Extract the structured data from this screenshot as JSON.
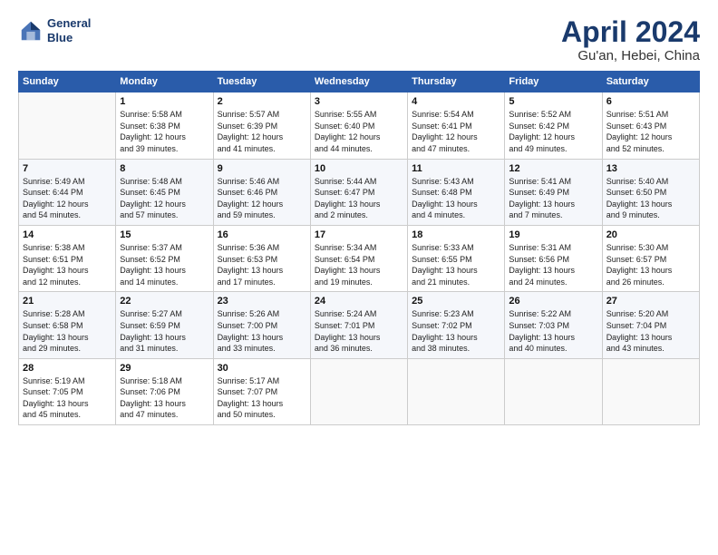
{
  "logo": {
    "line1": "General",
    "line2": "Blue"
  },
  "title": {
    "month_year": "April 2024",
    "location": "Gu'an, Hebei, China"
  },
  "weekdays": [
    "Sunday",
    "Monday",
    "Tuesday",
    "Wednesday",
    "Thursday",
    "Friday",
    "Saturday"
  ],
  "weeks": [
    [
      {
        "day": "",
        "detail": ""
      },
      {
        "day": "1",
        "detail": "Sunrise: 5:58 AM\nSunset: 6:38 PM\nDaylight: 12 hours\nand 39 minutes."
      },
      {
        "day": "2",
        "detail": "Sunrise: 5:57 AM\nSunset: 6:39 PM\nDaylight: 12 hours\nand 41 minutes."
      },
      {
        "day": "3",
        "detail": "Sunrise: 5:55 AM\nSunset: 6:40 PM\nDaylight: 12 hours\nand 44 minutes."
      },
      {
        "day": "4",
        "detail": "Sunrise: 5:54 AM\nSunset: 6:41 PM\nDaylight: 12 hours\nand 47 minutes."
      },
      {
        "day": "5",
        "detail": "Sunrise: 5:52 AM\nSunset: 6:42 PM\nDaylight: 12 hours\nand 49 minutes."
      },
      {
        "day": "6",
        "detail": "Sunrise: 5:51 AM\nSunset: 6:43 PM\nDaylight: 12 hours\nand 52 minutes."
      }
    ],
    [
      {
        "day": "7",
        "detail": "Sunrise: 5:49 AM\nSunset: 6:44 PM\nDaylight: 12 hours\nand 54 minutes."
      },
      {
        "day": "8",
        "detail": "Sunrise: 5:48 AM\nSunset: 6:45 PM\nDaylight: 12 hours\nand 57 minutes."
      },
      {
        "day": "9",
        "detail": "Sunrise: 5:46 AM\nSunset: 6:46 PM\nDaylight: 12 hours\nand 59 minutes."
      },
      {
        "day": "10",
        "detail": "Sunrise: 5:44 AM\nSunset: 6:47 PM\nDaylight: 13 hours\nand 2 minutes."
      },
      {
        "day": "11",
        "detail": "Sunrise: 5:43 AM\nSunset: 6:48 PM\nDaylight: 13 hours\nand 4 minutes."
      },
      {
        "day": "12",
        "detail": "Sunrise: 5:41 AM\nSunset: 6:49 PM\nDaylight: 13 hours\nand 7 minutes."
      },
      {
        "day": "13",
        "detail": "Sunrise: 5:40 AM\nSunset: 6:50 PM\nDaylight: 13 hours\nand 9 minutes."
      }
    ],
    [
      {
        "day": "14",
        "detail": "Sunrise: 5:38 AM\nSunset: 6:51 PM\nDaylight: 13 hours\nand 12 minutes."
      },
      {
        "day": "15",
        "detail": "Sunrise: 5:37 AM\nSunset: 6:52 PM\nDaylight: 13 hours\nand 14 minutes."
      },
      {
        "day": "16",
        "detail": "Sunrise: 5:36 AM\nSunset: 6:53 PM\nDaylight: 13 hours\nand 17 minutes."
      },
      {
        "day": "17",
        "detail": "Sunrise: 5:34 AM\nSunset: 6:54 PM\nDaylight: 13 hours\nand 19 minutes."
      },
      {
        "day": "18",
        "detail": "Sunrise: 5:33 AM\nSunset: 6:55 PM\nDaylight: 13 hours\nand 21 minutes."
      },
      {
        "day": "19",
        "detail": "Sunrise: 5:31 AM\nSunset: 6:56 PM\nDaylight: 13 hours\nand 24 minutes."
      },
      {
        "day": "20",
        "detail": "Sunrise: 5:30 AM\nSunset: 6:57 PM\nDaylight: 13 hours\nand 26 minutes."
      }
    ],
    [
      {
        "day": "21",
        "detail": "Sunrise: 5:28 AM\nSunset: 6:58 PM\nDaylight: 13 hours\nand 29 minutes."
      },
      {
        "day": "22",
        "detail": "Sunrise: 5:27 AM\nSunset: 6:59 PM\nDaylight: 13 hours\nand 31 minutes."
      },
      {
        "day": "23",
        "detail": "Sunrise: 5:26 AM\nSunset: 7:00 PM\nDaylight: 13 hours\nand 33 minutes."
      },
      {
        "day": "24",
        "detail": "Sunrise: 5:24 AM\nSunset: 7:01 PM\nDaylight: 13 hours\nand 36 minutes."
      },
      {
        "day": "25",
        "detail": "Sunrise: 5:23 AM\nSunset: 7:02 PM\nDaylight: 13 hours\nand 38 minutes."
      },
      {
        "day": "26",
        "detail": "Sunrise: 5:22 AM\nSunset: 7:03 PM\nDaylight: 13 hours\nand 40 minutes."
      },
      {
        "day": "27",
        "detail": "Sunrise: 5:20 AM\nSunset: 7:04 PM\nDaylight: 13 hours\nand 43 minutes."
      }
    ],
    [
      {
        "day": "28",
        "detail": "Sunrise: 5:19 AM\nSunset: 7:05 PM\nDaylight: 13 hours\nand 45 minutes."
      },
      {
        "day": "29",
        "detail": "Sunrise: 5:18 AM\nSunset: 7:06 PM\nDaylight: 13 hours\nand 47 minutes."
      },
      {
        "day": "30",
        "detail": "Sunrise: 5:17 AM\nSunset: 7:07 PM\nDaylight: 13 hours\nand 50 minutes."
      },
      {
        "day": "",
        "detail": ""
      },
      {
        "day": "",
        "detail": ""
      },
      {
        "day": "",
        "detail": ""
      },
      {
        "day": "",
        "detail": ""
      }
    ]
  ]
}
